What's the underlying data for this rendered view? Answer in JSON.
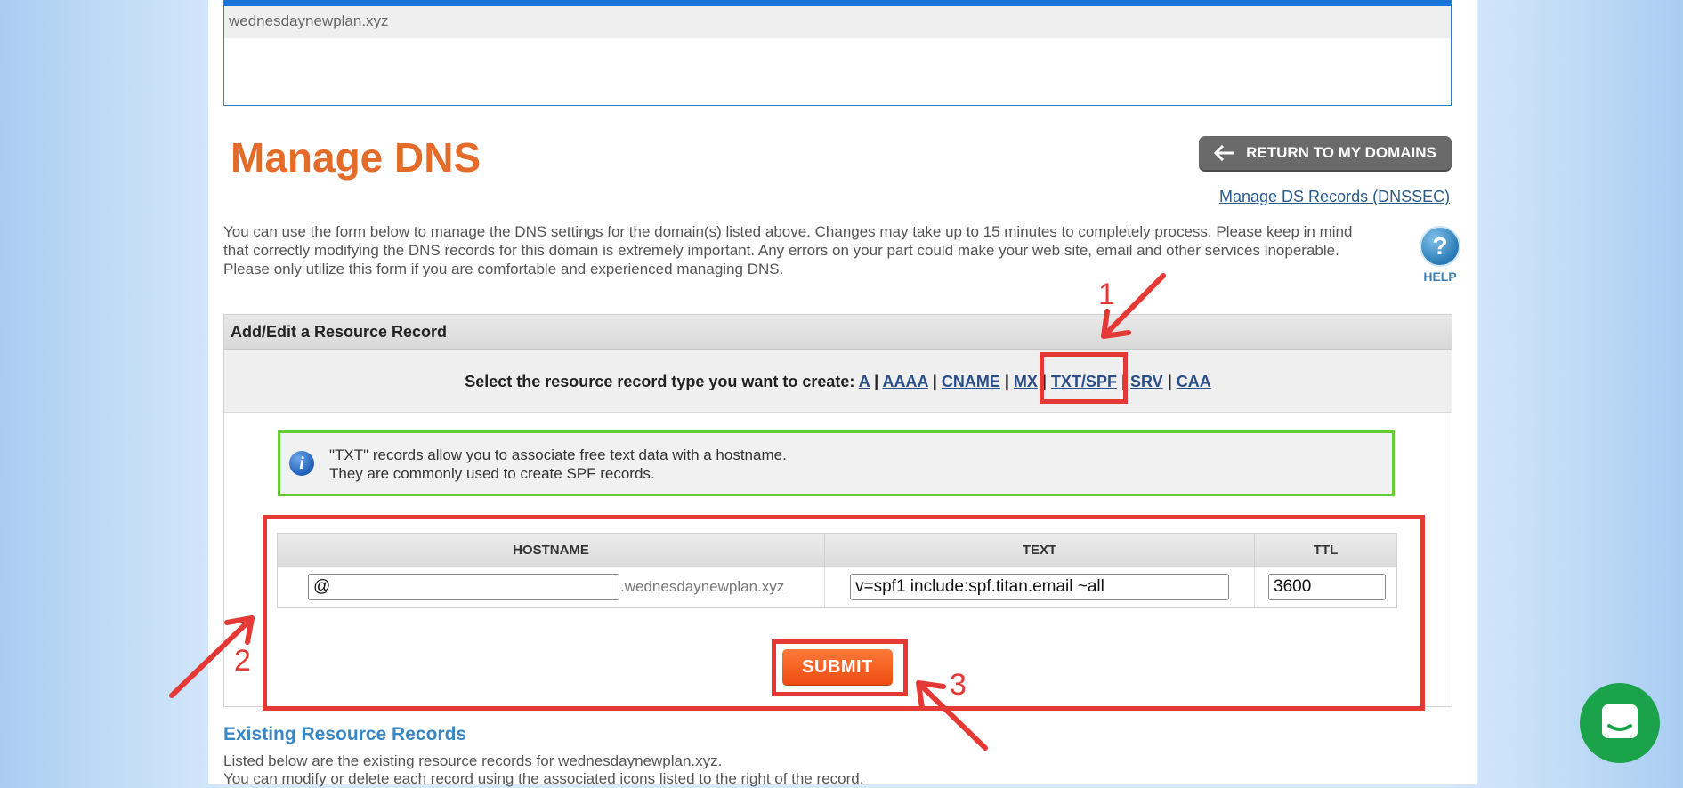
{
  "domain_list": {
    "selected_domain": "wednesdaynewplan.xyz"
  },
  "page": {
    "title": "Manage DNS",
    "return_button": "RETURN TO MY DOMAINS",
    "ds_link": "Manage DS Records (DNSSEC)",
    "intro": "You can use the form below to manage the DNS settings for the domain(s) listed above. Changes may take up to 15 minutes to completely process. Please keep in mind that correctly modifying the DNS records for this domain is extremely important. Any errors on your part could make your web site, email and other services inoperable. Please only utilize this form if you are comfortable and experienced managing DNS.",
    "help_label": "HELP",
    "help_glyph": "?"
  },
  "resource_record": {
    "header": "Add/Edit a Resource Record",
    "select_prompt": "Select the resource record type you want to create:",
    "types": [
      "A",
      "AAAA",
      "CNAME",
      "MX",
      "TXT/SPF",
      "SRV",
      "CAA"
    ],
    "info_line1": "\"TXT\" records allow you to associate free text data with a hostname.",
    "info_line2": "They are commonly used to create SPF records.",
    "columns": {
      "hostname": "HOSTNAME",
      "text": "TEXT",
      "ttl": "TTL"
    },
    "hostname_value": "@",
    "hostname_suffix": ".wednesdaynewplan.xyz",
    "text_value": "v=spf1 include:spf.titan.email ~all",
    "ttl_value": "3600",
    "submit_label": "SUBMIT"
  },
  "existing": {
    "title": "Existing Resource Records",
    "line1": "Listed below are the existing resource records for wednesdaynewplan.xyz.",
    "line2": "You can modify or delete each record using the associated icons listed to the right of the record."
  },
  "annotations": {
    "num1": "1",
    "num2": "2",
    "num3": "3",
    "color": "#e53935"
  },
  "icons": {
    "return": "arrow-left-icon",
    "help": "help-question-icon",
    "info": "info-icon",
    "chat": "chat-icon"
  },
  "colors": {
    "title": "#e36c2b",
    "link": "#2a4f88",
    "info_border": "#66cc33",
    "submit": "#ee4b10",
    "chat": "#1aa34a"
  }
}
